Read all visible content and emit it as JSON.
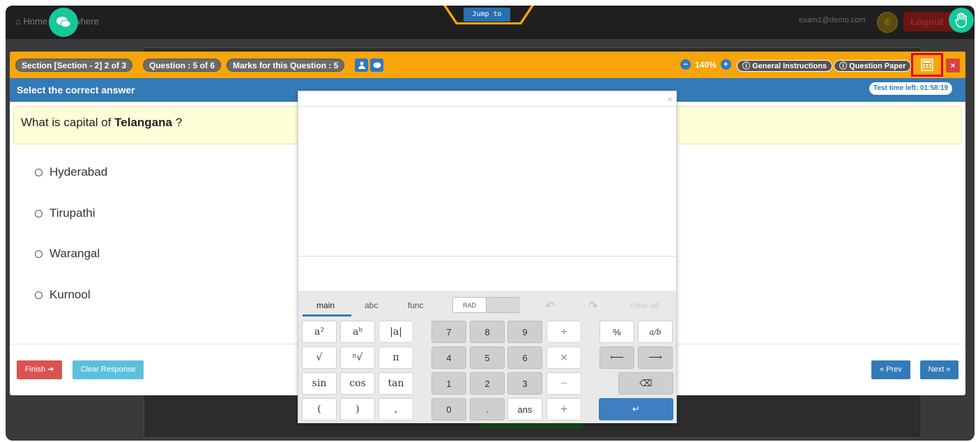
{
  "topbar": {
    "home_label": "Home",
    "anywhere_label": "n Anywhere",
    "jump_to_label": "Jump to",
    "email": "exam1@demo.com",
    "logout_label": "Logout"
  },
  "exam_header": {
    "section_label": "Section [Section - 2] 2 of 3",
    "question_label": "Question : 5 of 6",
    "marks_label": "Marks for this Question : 5",
    "zoom_value": "140%",
    "general_instructions_label": "General Instructions",
    "question_paper_label": "Question Paper",
    "close_label": "×"
  },
  "instruction_bar": {
    "title": "Select the correct answer",
    "timer_label": "Test time left: 01:58:19"
  },
  "question": {
    "prefix": "What is capital of ",
    "bold": "Telangana",
    "suffix": " ?"
  },
  "options": [
    "Hyderabad",
    "Tirupathi",
    "Warangal",
    "Kurnool"
  ],
  "footer": {
    "finish_label": "Finish ➔",
    "clear_label": "Clear Response",
    "prev_label": "« Prev",
    "next_label": "Next »"
  },
  "calculator": {
    "close_label": "×",
    "tabs": [
      "main",
      "abc",
      "func"
    ],
    "rad_label": "RAD",
    "clear_all_label": "clear all",
    "keys": {
      "a2": "a²",
      "ab": "aᵇ",
      "abs": "|a|",
      "sqrt": "√",
      "nroot": "ⁿ√",
      "pi": "π",
      "sin": "sin",
      "cos": "cos",
      "tan": "tan",
      "lparen": "(",
      "rparen": ")",
      "comma": ",",
      "n7": "7",
      "n8": "8",
      "n9": "9",
      "div": "÷",
      "n4": "4",
      "n5": "5",
      "n6": "6",
      "mul": "×",
      "n1": "1",
      "n2": "2",
      "n3": "3",
      "minus": "−",
      "n0": "0",
      "dot": ".",
      "ans": "ans",
      "plus": "+",
      "percent": "%",
      "frac": "a/b",
      "left": "⟵",
      "right": "⟶",
      "backspace": "⌫",
      "enter": "↵"
    }
  },
  "colors": {
    "accent_orange": "#f7a50a",
    "accent_blue": "#337ab7",
    "chat_green": "#16c79a",
    "highlight_red": "#e80000"
  }
}
